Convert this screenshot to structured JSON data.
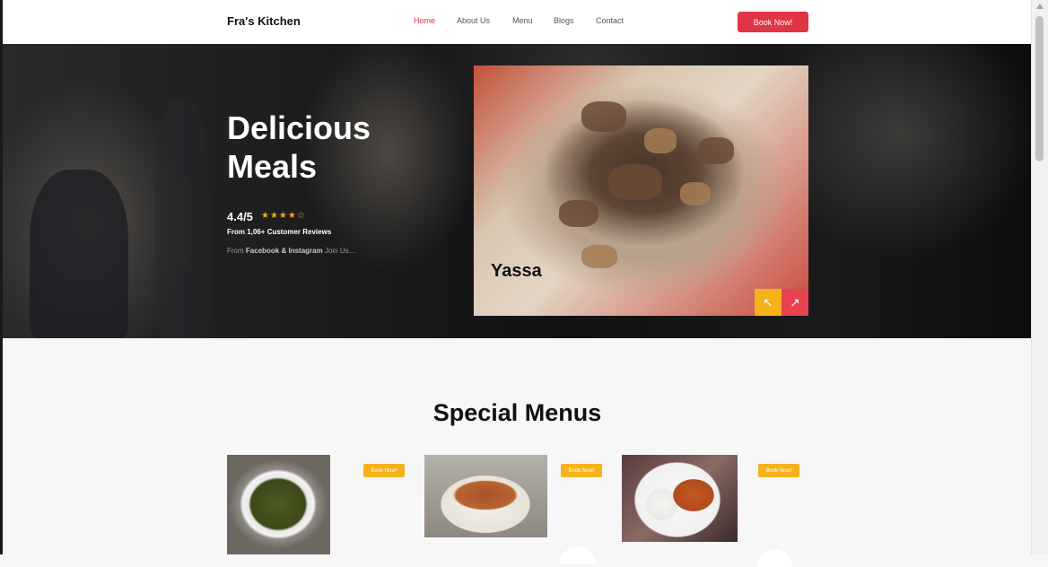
{
  "header": {
    "brand": "Fra's Kitchen",
    "nav": [
      "Home",
      "About Us",
      "Menu",
      "Blogs",
      "Contact"
    ],
    "active_nav": "Home",
    "book_label": "Book Now!"
  },
  "hero": {
    "title": "Delicious Meals",
    "rating": "4.4/5",
    "stars": "★★★★☆",
    "reviews": "From 1,06+ Customer Reviews",
    "social_prefix": "From",
    "social_brands": "Facebook & Instagram",
    "social_suffix": "Join Us...",
    "dish_name": "Yassa",
    "prev_icon": "arrow-up-left-icon",
    "next_icon": "arrow-up-right-icon",
    "prev_glyph": "↖",
    "next_glyph": "↗"
  },
  "specials": {
    "title": "Special Menus",
    "items": [
      {
        "book_label": "Book Now!"
      },
      {
        "book_label": "Book Now!"
      },
      {
        "book_label": "Book Now!"
      }
    ]
  },
  "colors": {
    "accent_red": "#e03545",
    "accent_yellow": "#f5b21b"
  }
}
